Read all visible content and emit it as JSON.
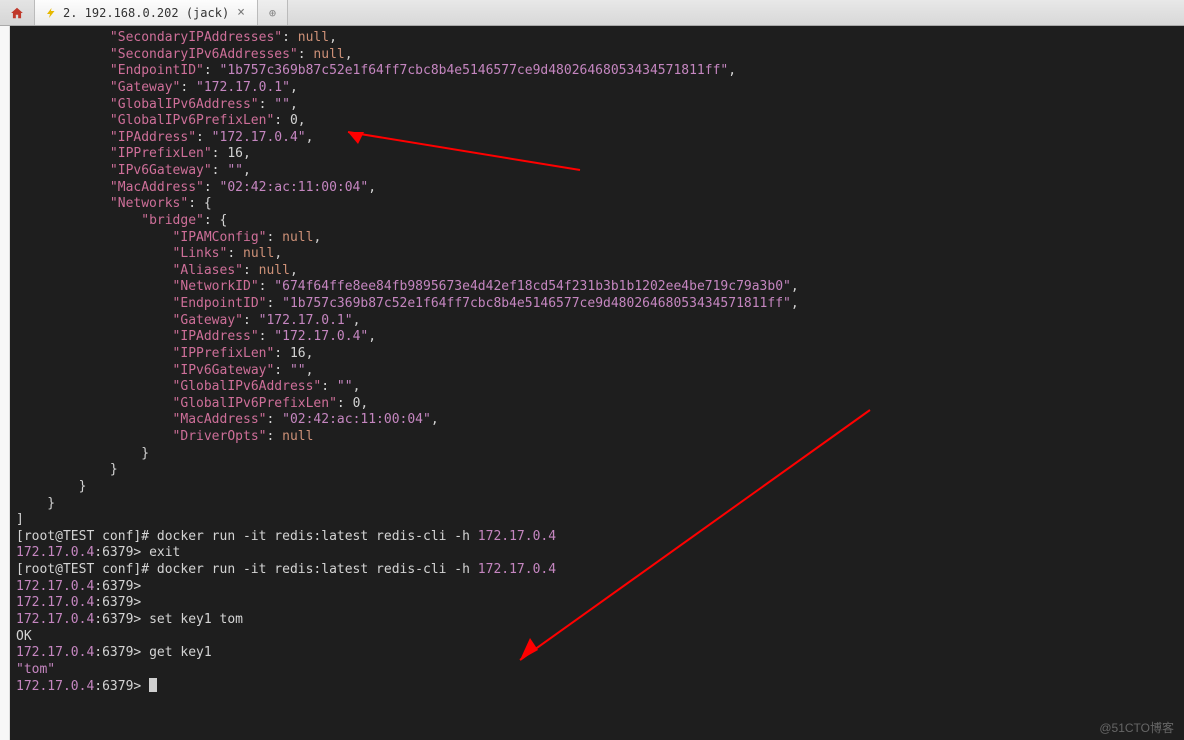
{
  "tabs": {
    "home_label": "",
    "active_label": "2. 192.168.0.202 (jack)",
    "new_tab_glyph": "⊕"
  },
  "json_output": {
    "indent1": "            ",
    "indent2": "                ",
    "indent3": "                    ",
    "SecondaryIPAddresses": "null",
    "SecondaryIPv6Addresses": "null",
    "EndpointID": "1b757c369b87c52e1f64ff7cbc8b4e5146577ce9d48026468053434571811ff",
    "Gateway": "172.17.0.1",
    "GlobalIPv6Address": "",
    "GlobalIPv6PrefixLen": "0",
    "IPAddress": "172.17.0.4",
    "IPPrefixLen": "16",
    "IPv6Gateway": "",
    "MacAddress": "02:42:ac:11:00:04",
    "Networks_key": "Networks",
    "bridge_key": "bridge",
    "bridge": {
      "IPAMConfig": "null",
      "Links": "null",
      "Aliases": "null",
      "NetworkID": "674f64ffe8ee84fb9895673e4d42ef18cd54f231b3b1b1202ee4be719c79a3b0",
      "EndpointID": "1b757c369b87c52e1f64ff7cbc8b4e5146577ce9d48026468053434571811ff",
      "Gateway": "172.17.0.1",
      "IPAddress": "172.17.0.4",
      "IPPrefixLen": "16",
      "IPv6Gateway": "",
      "GlobalIPv6Address": "",
      "GlobalIPv6PrefixLen": "0",
      "MacAddress": "02:42:ac:11:00:04",
      "DriverOpts": "null"
    },
    "closing1": "                }",
    "closing2": "            }",
    "closing3": "        }",
    "closing4": "    }",
    "closing5": "]"
  },
  "shell": {
    "prompt1": "[root@TEST conf]# ",
    "cmd1": "docker run -it redis:latest redis-cli -h ",
    "cmd1_ip": "172.17.0.4",
    "redis_host": "172.17.0.4",
    "redis_port": ":6379> ",
    "exit": "exit",
    "prompt2": "[root@TEST conf]# ",
    "cmd2": "docker run -it redis:latest redis-cli -h ",
    "cmd2_ip": "172.17.0.4",
    "set_cmd": "set key1 tom",
    "ok": "OK",
    "get_cmd": "get key1",
    "get_result": "\"tom\""
  },
  "watermark": "@51CTO博客"
}
